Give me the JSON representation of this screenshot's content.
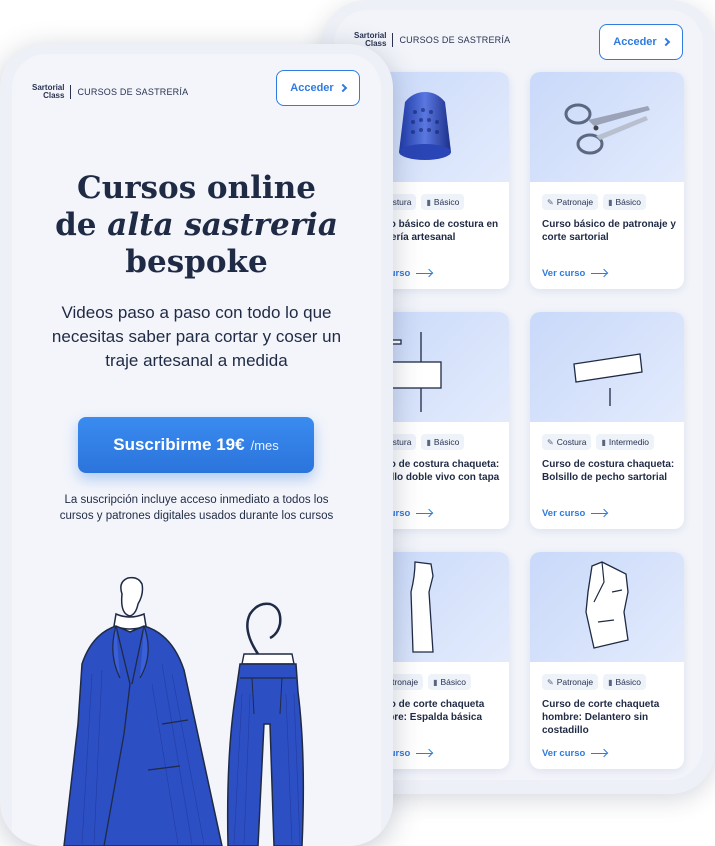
{
  "brand": {
    "logo_line1": "Sartorial",
    "logo_line2": "Class",
    "section": "CURSOS DE SASTRERÍA"
  },
  "header": {
    "login_label": "Acceder"
  },
  "hero": {
    "title_line1": "Cursos online",
    "title_line2_prefix": "de ",
    "title_line2_emph": "alta sastreria",
    "title_line3": "bespoke",
    "subtitle": "Videos paso a paso con todo lo que necesitas saber para cortar y coser un traje artesanal a medida",
    "cta_main": "Suscribirme 19€",
    "cta_period": "/mes",
    "note": "La suscripción incluye acceso inmediato a todos los cursos y  patrones digitales usados durante los cursos"
  },
  "colors": {
    "accent": "#2f7be0",
    "navy": "#1f2a44",
    "suit": "#2d4fc4"
  },
  "courses": [
    {
      "icon": "thimble-icon",
      "tag1_icon": "needle-icon",
      "tag1": "Costura",
      "tag2": "Básico",
      "title": "Curso básico de costura en sastrería artesanal",
      "cta": "Ver curso"
    },
    {
      "icon": "scissors-icon",
      "tag1_icon": "pencil-icon",
      "tag1": "Patronaje",
      "tag2": "Básico",
      "title": "Curso básico de patronaje y corte sartorial",
      "cta": "Ver curso"
    },
    {
      "icon": "pocket-piping-icon",
      "tag1_icon": "needle-icon",
      "tag1": "Costura",
      "tag2": "Básico",
      "title": "Curso de costura chaqueta: Bolsillo doble vivo con tapa",
      "cta": "Ver curso"
    },
    {
      "icon": "breast-pocket-icon",
      "tag1_icon": "needle-icon",
      "tag1": "Costura",
      "tag2": "Intermedio",
      "title": "Curso de costura chaqueta: Bolsillo de pecho sartorial",
      "cta": "Ver curso"
    },
    {
      "icon": "back-panel-icon",
      "tag1_icon": "pencil-icon",
      "tag1": "Patronaje",
      "tag2": "Básico",
      "title": "Curso de corte chaqueta hombre:  Espalda básica",
      "cta": "Ver curso"
    },
    {
      "icon": "jacket-front-icon",
      "tag1_icon": "pencil-icon",
      "tag1": "Patronaje",
      "tag2": "Básico",
      "title": "Curso de corte chaqueta hombre: Delantero sin costadillo",
      "cta": "Ver curso"
    }
  ]
}
